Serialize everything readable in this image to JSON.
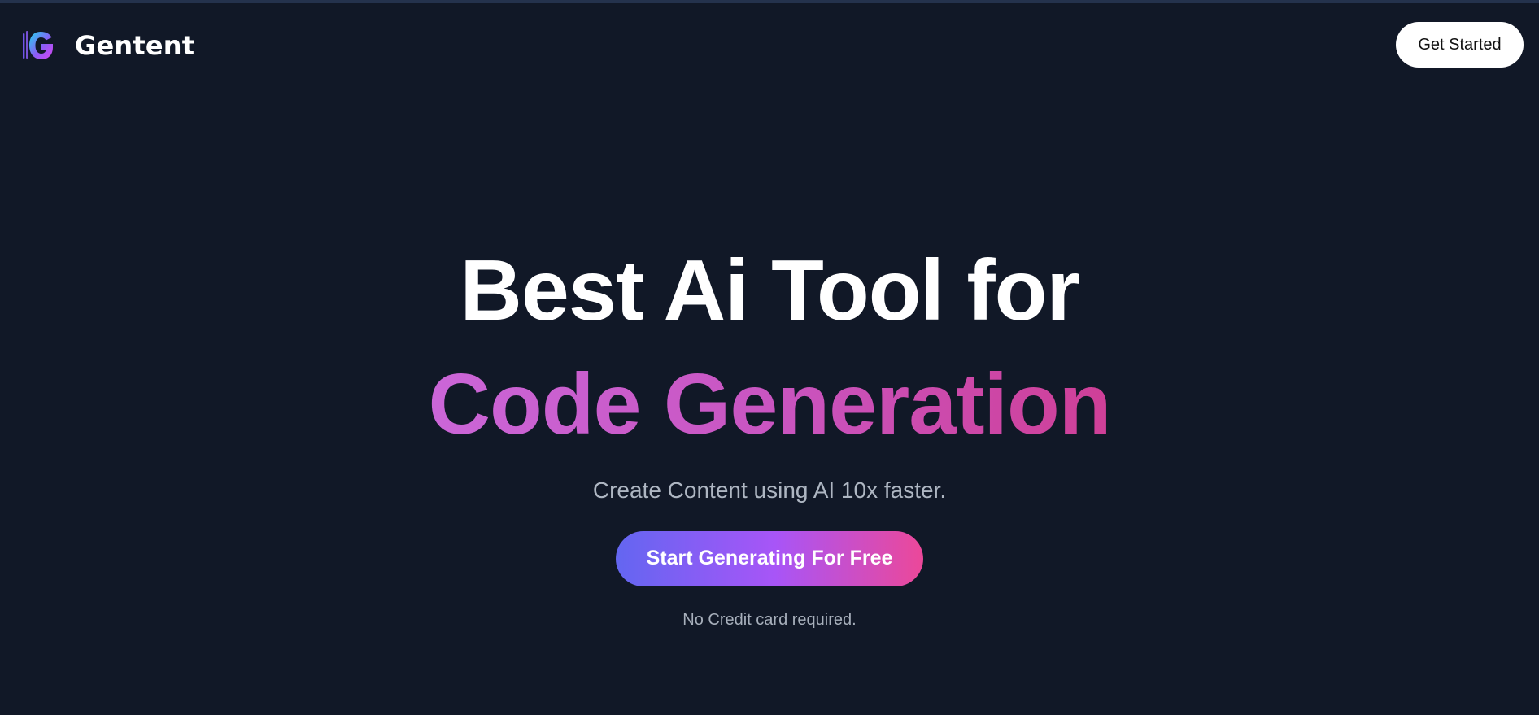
{
  "header": {
    "brand_name": "Gentent",
    "logo_icon": "gentent-g-logo-icon",
    "get_started_label": "Get Started"
  },
  "hero": {
    "headline_line1": "Best Ai Tool for",
    "headline_line2": "Code Generation",
    "subtitle": "Create Content using AI 10x faster.",
    "cta_label": "Start Generating For Free",
    "note": "No Credit card required."
  },
  "colors": {
    "background": "#111827",
    "headline_gradient": [
      "#cb66d8",
      "#cf3f97"
    ],
    "cta_gradient": [
      "#6366f1",
      "#a855f7",
      "#ec4899"
    ],
    "subtitle": "#aeb6c2"
  }
}
